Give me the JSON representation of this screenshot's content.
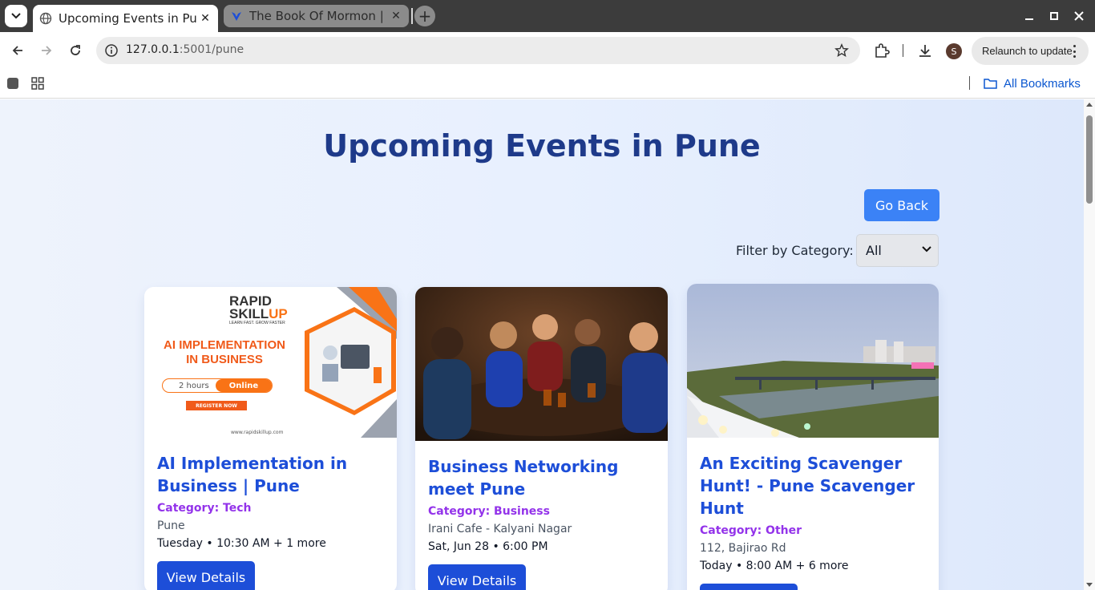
{
  "browser": {
    "tabs": [
      {
        "title": "Upcoming Events in Pune",
        "active": true
      },
      {
        "title": "The Book Of Mormon |",
        "active": false
      }
    ],
    "url_host": "127.0.0.1",
    "url_rest": ":5001/pune",
    "profile_initial": "S",
    "relaunch_label": "Relaunch to update",
    "all_bookmarks_label": "All Bookmarks"
  },
  "page": {
    "title": "Upcoming Events in Pune",
    "go_back_label": "Go Back",
    "filter_label": "Filter by Category:",
    "filter_value": "All",
    "view_details_label": "View Details"
  },
  "events": [
    {
      "title": "AI Implementation in Business | Pune",
      "category": "Category: Tech",
      "location": "Pune",
      "time": "Tuesday • 10:30 AM + 1 more",
      "image": {
        "brand_line1": "RAPID",
        "brand_line2": "SKILL",
        "brand_line2_accent": "UP",
        "tagline": "LEARN FAST. GROW FASTER",
        "headline1": "AI IMPLEMENTATION",
        "headline2": "IN BUSINESS",
        "duration": "2 hours",
        "mode": "Online",
        "cta": "REGISTER NOW",
        "site": "www.rapidskillup.com"
      }
    },
    {
      "title": "Business Networking meet Pune",
      "category": "Category: Business",
      "location": "Irani Cafe - Kalyani Nagar",
      "time": "Sat, Jun 28 • 6:00 PM"
    },
    {
      "title": "An Exciting Scavenger Hunt! - Pune Scavenger Hunt",
      "category": "Category: Other",
      "location": "112, Bajirao Rd",
      "time": "Today • 8:00 AM + 6 more"
    }
  ]
}
